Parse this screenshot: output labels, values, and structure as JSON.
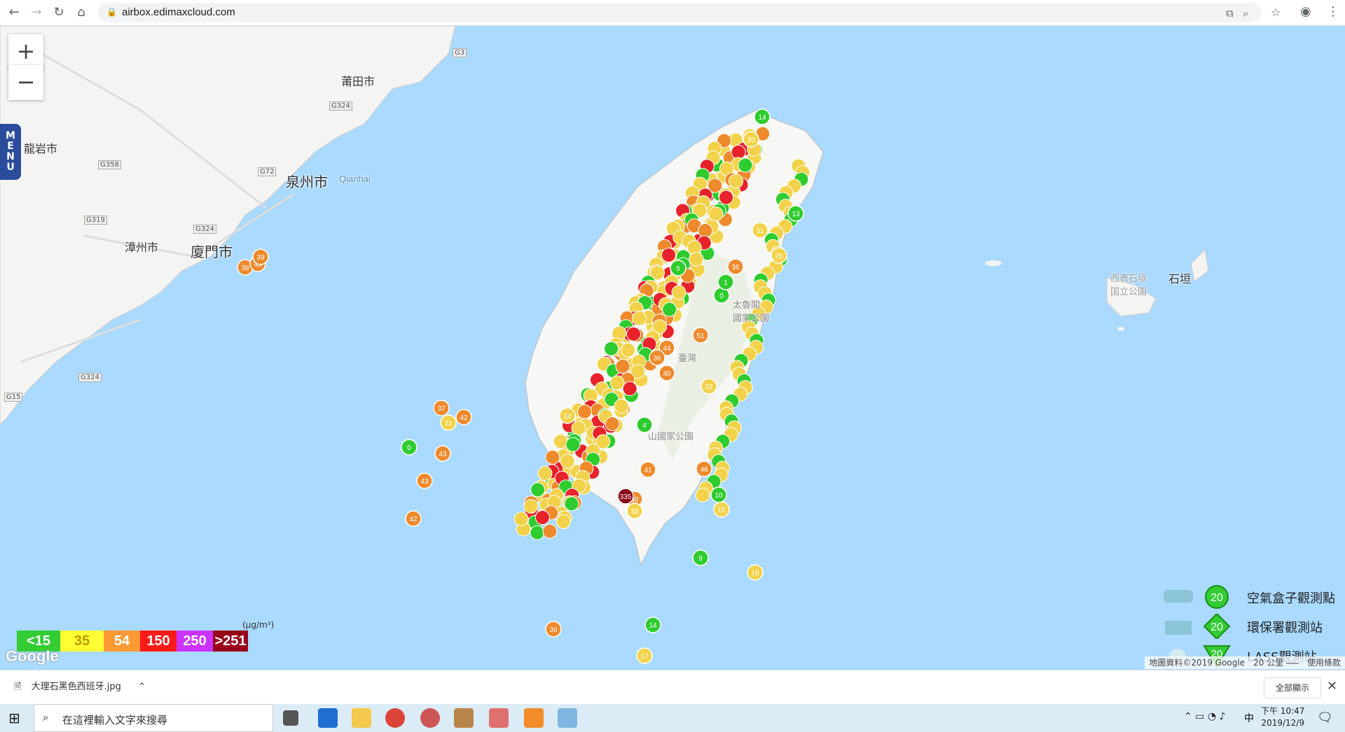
{
  "browser": {
    "url": "airbox.edimaxcloud.com",
    "back_icon": "←",
    "forward_icon": "→",
    "reload_icon": "↻",
    "home_icon": "⌂"
  },
  "map": {
    "menu_label": "MENU",
    "zoom_in": "+",
    "zoom_out": "−",
    "cities": {
      "putian": "莆田市",
      "longyan": "龍岩市",
      "quanzhou": "泉州市",
      "qianhai": "Qianhai",
      "zhangzhou": "漳州市",
      "xiamen": "廈門市",
      "shigaki": "石垣",
      "iriomote": "西表石垣\n国立公園",
      "taroko": "太魯閣\n國家公園",
      "taiwan": "臺灣",
      "yushan": "山國家公園"
    },
    "roads": [
      "G3",
      "G324",
      "G72",
      "G358",
      "G319",
      "G324",
      "G324",
      "G15"
    ],
    "scale_bar": [
      {
        "label": "<15",
        "color": "#33cc33"
      },
      {
        "label": "35",
        "color": "#ffff33"
      },
      {
        "label": "54",
        "color": "#ff9933"
      },
      {
        "label": "150",
        "color": "#ff1a1a"
      },
      {
        "label": "250",
        "color": "#cc33ff"
      },
      {
        "label": ">251",
        "color": "#99001a"
      }
    ],
    "unit": "(μg/m³)",
    "google": "Google",
    "legend": {
      "airbox": "空氣盒子觀測點",
      "epa": "環保署觀測站",
      "lass": "LASS觀測站",
      "value": "20"
    },
    "attribution": "地圖資料©2019 Google　20 公里 ⎯⎯⎯　使用條款",
    "markers_sample": [
      "38",
      "45",
      "39",
      "37",
      "21",
      "42",
      "43",
      "0",
      "43",
      "42",
      "14",
      "20",
      "24",
      "5",
      "0",
      "1",
      "36",
      "51",
      "44",
      "40",
      "36",
      "4",
      "41",
      "38",
      "335",
      "46",
      "15",
      "9",
      "19",
      "14",
      "36",
      "17",
      "10",
      "33",
      "31",
      "22",
      "26",
      "13"
    ]
  },
  "downloads": {
    "file": "大理石黑色西班牙.jpg",
    "show_all": "全部顯示",
    "close": "✕"
  },
  "taskbar": {
    "search_placeholder": "在這裡輸入文字來搜尋",
    "time": "下午 10:47",
    "date": "2019/12/9",
    "ime": "中"
  }
}
